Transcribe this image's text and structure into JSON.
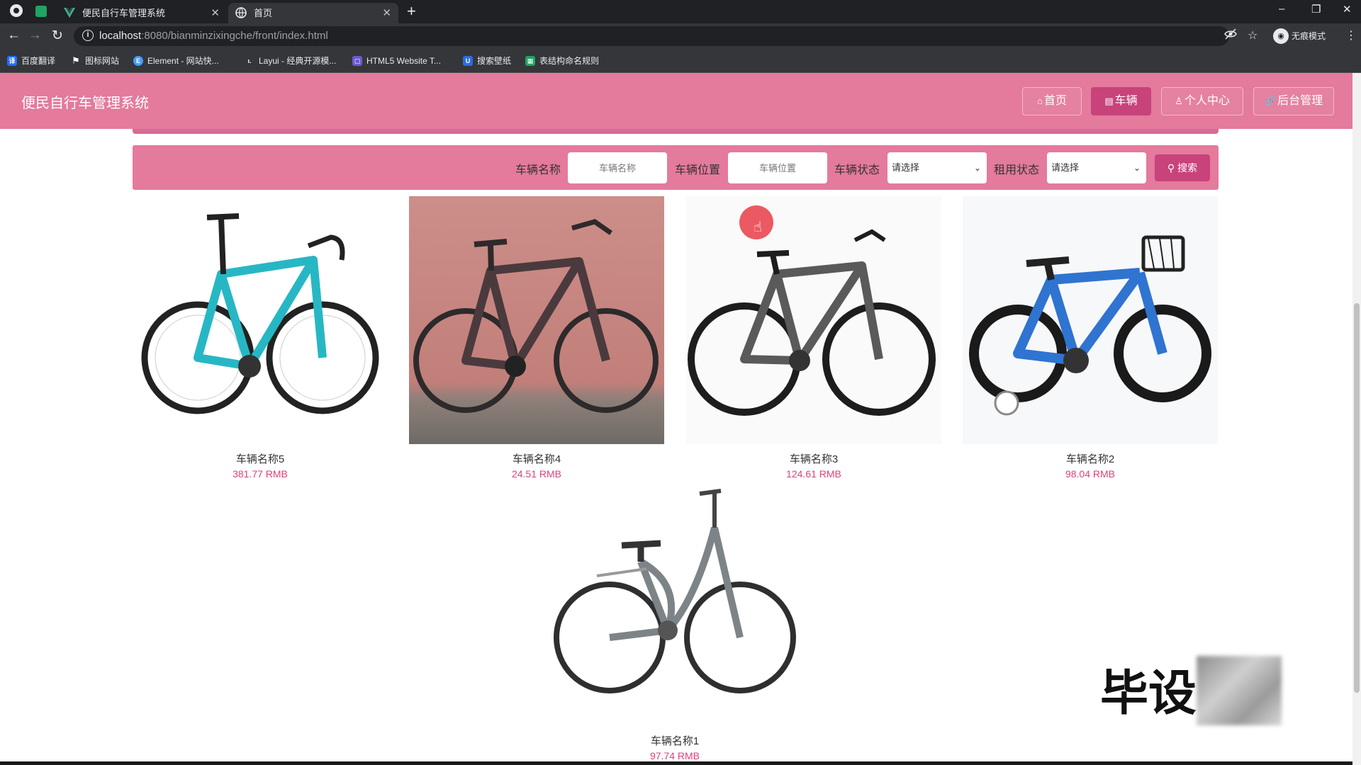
{
  "browser": {
    "tabs": [
      {
        "title": "便民自行车管理系统",
        "active": false
      },
      {
        "title": "首页",
        "active": true
      }
    ],
    "url_host": "localhost",
    "url_path": ":8080/bianminzixingche/front/index.html",
    "incognito_label": "无痕模式",
    "bookmarks": [
      {
        "label": "百度翻译",
        "color": "#1e6fff"
      },
      {
        "label": "图标网站",
        "color": "#333333"
      },
      {
        "label": "Element - 网站快...",
        "color": "#409eff"
      },
      {
        "label": "Layui - 经典开源模...",
        "color": "#555555"
      },
      {
        "label": "HTML5 Website T...",
        "color": "#6a5acd"
      },
      {
        "label": "搜索壁纸",
        "color": "#2b6de0"
      },
      {
        "label": "表结构命名规则",
        "color": "#1fa463"
      }
    ]
  },
  "header": {
    "site_title": "便民自行车管理系统",
    "nav": [
      {
        "icon": "home-icon",
        "label": "首页",
        "active": false
      },
      {
        "icon": "bike-list-icon",
        "label": "车辆",
        "active": true
      },
      {
        "icon": "user-icon",
        "label": "个人中心",
        "active": false
      },
      {
        "icon": "link-icon",
        "label": "后台管理",
        "active": false
      }
    ]
  },
  "search": {
    "name_label": "车辆名称",
    "name_placeholder": "车辆名称",
    "location_label": "车辆位置",
    "location_placeholder": "车辆位置",
    "status_label": "车辆状态",
    "status_value": "请选择",
    "rent_label": "租用状态",
    "rent_value": "请选择",
    "button_label": "搜索"
  },
  "products": [
    {
      "name": "车辆名称5",
      "price": "381.77 RMB",
      "frame_color": "#27b7c4",
      "bg": "#ffffff"
    },
    {
      "name": "车辆名称4",
      "price": "24.51 RMB",
      "frame_color": "#4a3a3e",
      "bg": "#c98b86"
    },
    {
      "name": "车辆名称3",
      "price": "124.61 RMB",
      "frame_color": "#5a5a5a",
      "bg": "#ffffff"
    },
    {
      "name": "车辆名称2",
      "price": "98.04 RMB",
      "frame_color": "#2f74d0",
      "bg": "#ffffff"
    },
    {
      "name": "车辆名称1",
      "price": "97.74 RMB",
      "frame_color": "#7d8488",
      "bg": "#ffffff"
    }
  ],
  "watermark_text": "毕设"
}
